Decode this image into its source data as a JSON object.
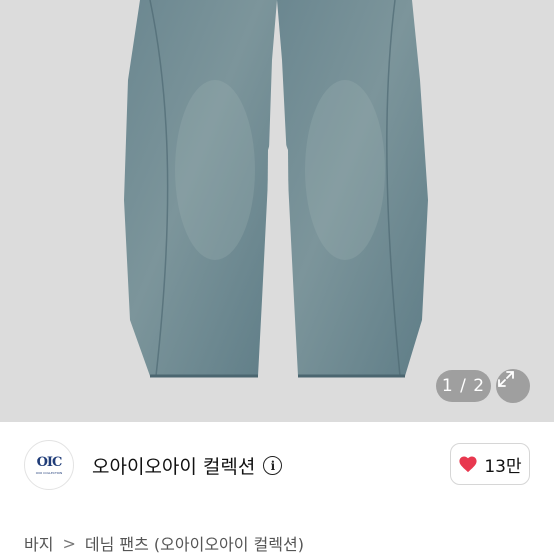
{
  "gallery": {
    "current_page": 1,
    "total_pages": 2,
    "indicator_text": "1 / 2",
    "expand_icon": "expand-icon",
    "background_color": "#dcdcdc",
    "product_color": "#6e8891"
  },
  "seller": {
    "avatar_logo": "OIC",
    "avatar_subtext": "OIOI COLLECTION",
    "name": "오아이오아이 컬렉션",
    "info_icon": "info-icon",
    "info_glyph": "i"
  },
  "like": {
    "icon": "heart-icon",
    "count": "13만",
    "color": "#e8384f"
  },
  "breadcrumb": {
    "items": [
      "바지",
      "데님 팬츠 (오아이오아이 컬렉션)"
    ],
    "separator": ">"
  }
}
